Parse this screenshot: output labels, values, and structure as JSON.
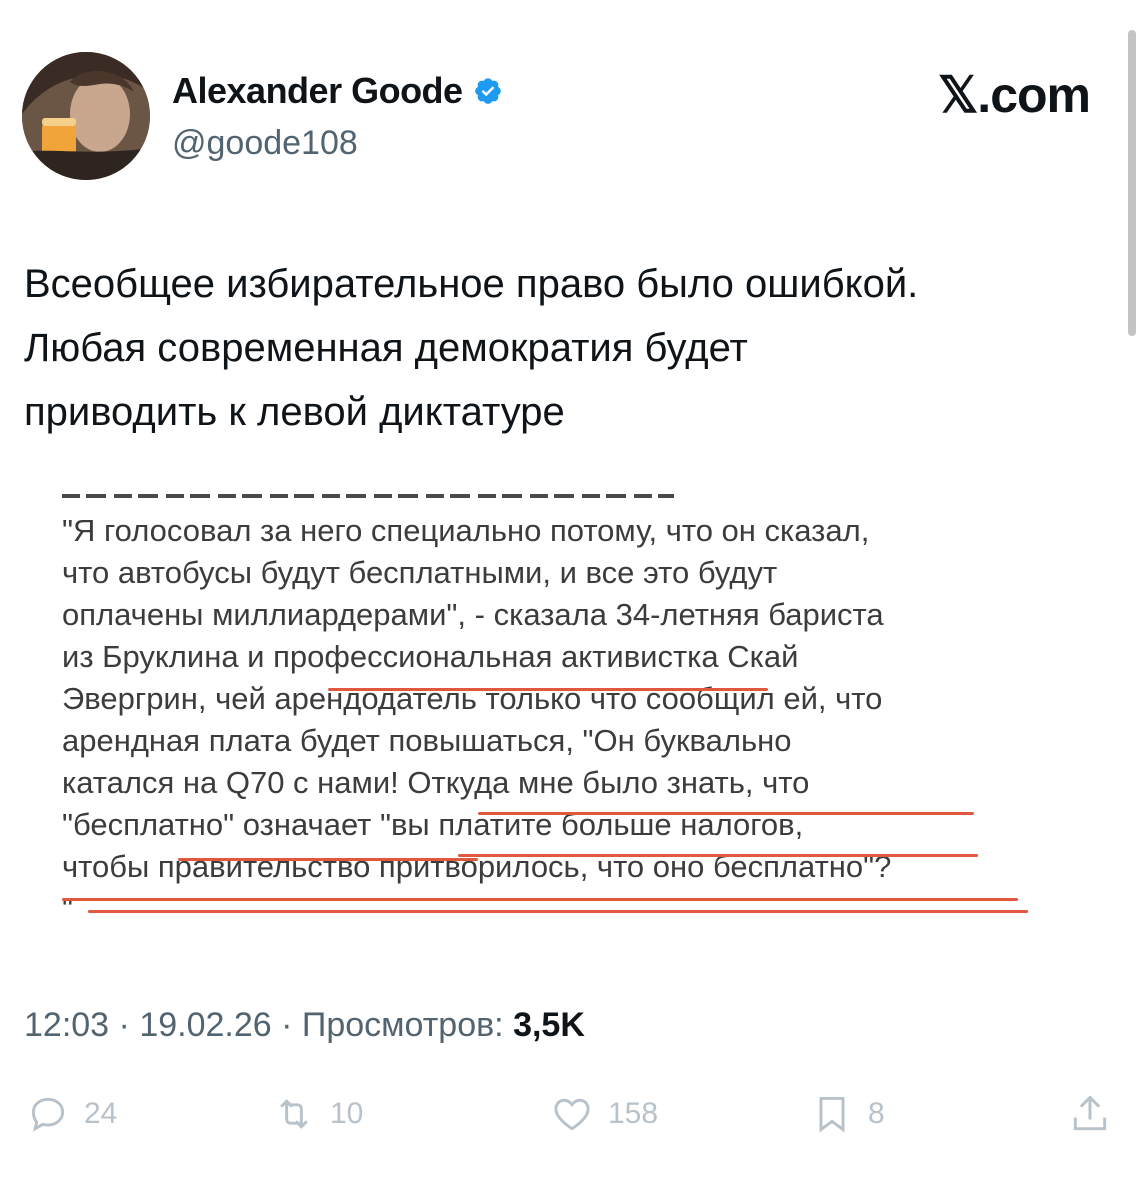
{
  "author": {
    "display_name": "Alexander Goode",
    "handle": "@goode108",
    "verified": true,
    "avatar_icon": "user-avatar-photo"
  },
  "brand": "𝕏.com",
  "tweet": {
    "lines": [
      "Всеобщее избирательное право было ошибкой.",
      "Любая современная демократия будет",
      "приводить к левой диктатуре"
    ]
  },
  "quote_image": {
    "lines": [
      "\"Я голосовал за него специально потому, что он сказал,",
      "что автобусы будут бесплатными, и все это будут",
      "оплачены миллиардерами\", - сказала 34-летняя бариста",
      "из Бруклина и профессиональная активистка Скай",
      "Эвергрин, чей арендодатель только что сообщил ей, что",
      "арендная плата будет повышаться, \"Он буквально",
      "катался на Q70 с нами! Откуда мне было знать, что",
      "\"бесплатно\" означает \"вы платите больше налогов,",
      "чтобы правительство притворилось, что оно бесплатно\"?",
      "\""
    ],
    "underline_color": "#e0583f"
  },
  "meta": {
    "time": "12:03",
    "date": "19.02.26",
    "separator": "·",
    "views_label": "Просмотров:",
    "views_count": "3,5K"
  },
  "actions": {
    "replies": {
      "icon": "reply-icon",
      "count": "24"
    },
    "reposts": {
      "icon": "repost-icon",
      "count": "10"
    },
    "likes": {
      "icon": "like-icon",
      "count": "158"
    },
    "bookmarks": {
      "icon": "bookmark-icon",
      "count": "8"
    },
    "share": {
      "icon": "share-icon"
    }
  },
  "colors": {
    "text_primary": "#0f1419",
    "text_secondary": "#536471",
    "verified_blue": "#1d9bf0",
    "action_gray": "#b8c2cb"
  }
}
